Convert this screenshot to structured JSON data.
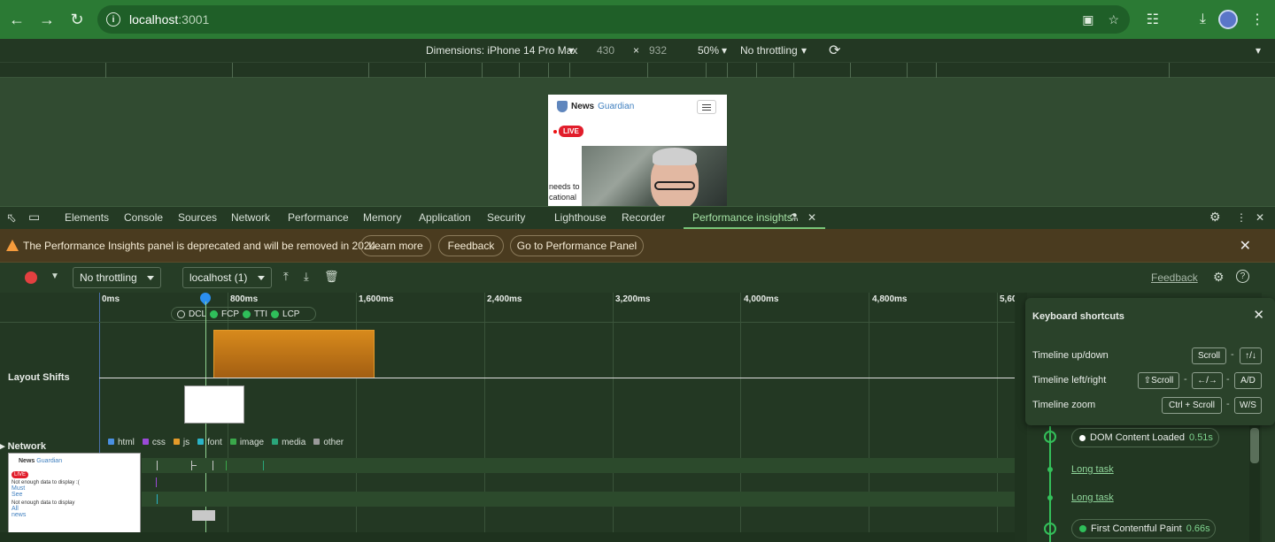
{
  "browser": {
    "url_host": "localhost",
    "url_port": ":3001",
    "nav_icons": [
      "back-icon",
      "forward-icon",
      "reload-icon",
      "info-icon"
    ],
    "right_icons": [
      "install-icon",
      "star-icon",
      "extensions-icon",
      "download-icon",
      "avatar",
      "menu-icon"
    ]
  },
  "device_toolbar": {
    "dimensions_label": "Dimensions: iPhone 14 Pro Max",
    "width": "430",
    "times": "×",
    "height": "932",
    "zoom": "50%",
    "throttling": "No throttling"
  },
  "phone_preview": {
    "brand_news": "News",
    "brand_guardian": "Guardian",
    "live_badge": "LIVE",
    "cut_text_1": "needs to",
    "cut_text_2": "cational"
  },
  "devtools_tabs": {
    "items": [
      "Elements",
      "Console",
      "Sources",
      "Network",
      "Performance",
      "Memory",
      "Application",
      "Security",
      "Lighthouse",
      "Recorder",
      "Performance insights"
    ],
    "active": "Performance insights"
  },
  "banner": {
    "message": "The Performance Insights panel is deprecated and will be removed in 2024.",
    "learn_more": "Learn more",
    "feedback": "Feedback",
    "go_to": "Go to Performance Panel"
  },
  "perf_toolbar": {
    "throttling": "No throttling",
    "recording": "localhost (1)",
    "feedback_link": "Feedback"
  },
  "timeline": {
    "ticks": [
      "0ms",
      "800ms",
      "1,600ms",
      "2,400ms",
      "3,200ms",
      "4,000ms",
      "4,800ms",
      "5,60"
    ],
    "markers": [
      "DCL",
      "FCP",
      "TTI",
      "LCP"
    ],
    "layout_shifts_label": "Layout Shifts",
    "network_label": "Network",
    "legend": [
      {
        "label": "html",
        "color": "#4a90e2"
      },
      {
        "label": "css",
        "color": "#9b4ad8"
      },
      {
        "label": "js",
        "color": "#e39a2a"
      },
      {
        "label": "font",
        "color": "#2bb3c7"
      },
      {
        "label": "image",
        "color": "#3aa84a"
      },
      {
        "label": "media",
        "color": "#2aa57a"
      },
      {
        "label": "other",
        "color": "#9a9a9a"
      }
    ],
    "net_card": {
      "brand_news": "News",
      "brand_guardian": "Guardian",
      "live": "LIVE",
      "line1": "Not enough data to display :(",
      "line2": "Must",
      "line3": "See",
      "line4": "Not enough data to display",
      "line5": "All",
      "line6": "news"
    }
  },
  "keyboard_shortcuts": {
    "title": "Keyboard shortcuts",
    "rows": [
      {
        "label": "Timeline up/down",
        "key1": "Scroll",
        "sep": "-",
        "key2": "↑/↓"
      },
      {
        "label": "Timeline left/right",
        "key1": "⇧Scroll",
        "sep": "-",
        "key2": "←/→",
        "sep2": "-",
        "key3": "A/D"
      },
      {
        "label": "Timeline zoom",
        "key1": "Ctrl + Scroll",
        "sep": "-",
        "key2": "W/S"
      }
    ]
  },
  "insights_events": {
    "dcl_label": "DOM Content Loaded",
    "dcl_time": "0.51s",
    "long_task_1": "Long task",
    "long_task_2": "Long task",
    "fcp_label": "First Contentful Paint",
    "fcp_time": "0.66s"
  }
}
